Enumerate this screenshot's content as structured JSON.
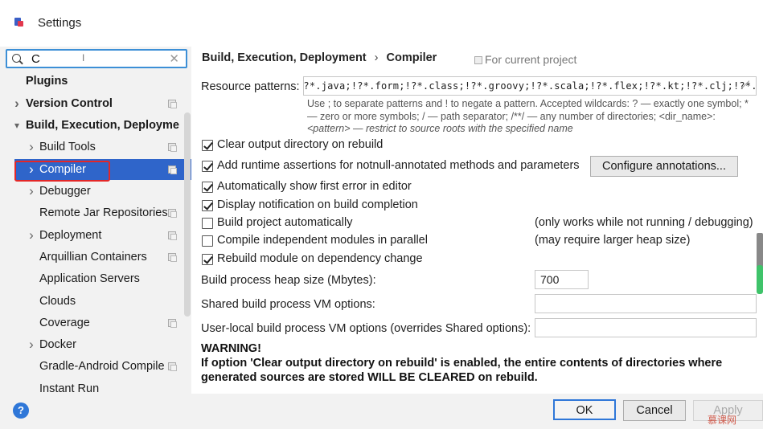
{
  "window": {
    "title": "Settings"
  },
  "search": {
    "value": "C"
  },
  "tree": [
    {
      "label": "Plugins",
      "bold": true,
      "arrow": "",
      "project": false
    },
    {
      "label": "Version Control",
      "bold": true,
      "arrow": "›",
      "project": true
    },
    {
      "label": "Build, Execution, Deployme",
      "bold": true,
      "arrow": "⌄",
      "project": false
    },
    {
      "label": "Build Tools",
      "bold": false,
      "arrow": "›",
      "project": true
    },
    {
      "label": "Compiler",
      "bold": false,
      "arrow": "›",
      "project": true,
      "selected": true
    },
    {
      "label": "Debugger",
      "bold": false,
      "arrow": "›",
      "project": false
    },
    {
      "label": "Remote Jar Repositories",
      "bold": false,
      "arrow": "",
      "project": true
    },
    {
      "label": "Deployment",
      "bold": false,
      "arrow": "›",
      "project": true
    },
    {
      "label": "Arquillian Containers",
      "bold": false,
      "arrow": "",
      "project": true
    },
    {
      "label": "Application Servers",
      "bold": false,
      "arrow": "",
      "project": false
    },
    {
      "label": "Clouds",
      "bold": false,
      "arrow": "",
      "project": false
    },
    {
      "label": "Coverage",
      "bold": false,
      "arrow": "",
      "project": true
    },
    {
      "label": "Docker",
      "bold": false,
      "arrow": "›",
      "project": false
    },
    {
      "label": "Gradle-Android Compile",
      "bold": false,
      "arrow": "",
      "project": true
    },
    {
      "label": "Instant Run",
      "bold": false,
      "arrow": "",
      "project": false
    }
  ],
  "breadcrumb": {
    "parent": "Build, Execution, Deployment",
    "separator": "›",
    "current": "Compiler"
  },
  "for_current_project": "For current project",
  "resource_patterns": {
    "label": "Resource patterns:",
    "value": "!?*.java;!?*.form;!?*.class;!?*.groovy;!?*.scala;!?*.flex;!?*.kt;!?*.clj;!?*.aj",
    "hint_line1": "Use ; to separate patterns and ! to negate a pattern. Accepted wildcards: ? — exactly one symbol; *",
    "hint_line2": "— zero or more symbols; / — path separator; /**/ — any number of directories; <dir_name>:",
    "hint_line3": "<pattern> — restrict to source roots with the specified name"
  },
  "checkboxes": [
    {
      "label": "Clear output directory on rebuild",
      "checked": true
    },
    {
      "label": "Add runtime assertions for notnull-annotated methods and parameters",
      "checked": true
    },
    {
      "label": "Automatically show first error in editor",
      "checked": true
    },
    {
      "label": "Display notification on build completion",
      "checked": true
    },
    {
      "label": "Build project automatically",
      "checked": false,
      "note": "(only works while not running / debugging)"
    },
    {
      "label": "Compile independent modules in parallel",
      "checked": false,
      "note": "(may require larger heap size)"
    },
    {
      "label": "Rebuild module on dependency change",
      "checked": true
    }
  ],
  "configure_annotations": "Configure annotations...",
  "heap": {
    "label": "Build process heap size (Mbytes):",
    "value": "700"
  },
  "shared_vm": {
    "label": "Shared build process VM options:",
    "value": ""
  },
  "user_vm": {
    "label": "User-local build process VM options (overrides Shared options):",
    "value": ""
  },
  "warning": {
    "title": "WARNING!",
    "text": "If option 'Clear output directory on rebuild' is enabled, the entire contents of directories where generated sources are stored WILL BE CLEARED on rebuild."
  },
  "buttons": {
    "ok": "OK",
    "cancel": "Cancel",
    "apply": "Apply",
    "help": "?"
  },
  "watermark": "慕课网"
}
